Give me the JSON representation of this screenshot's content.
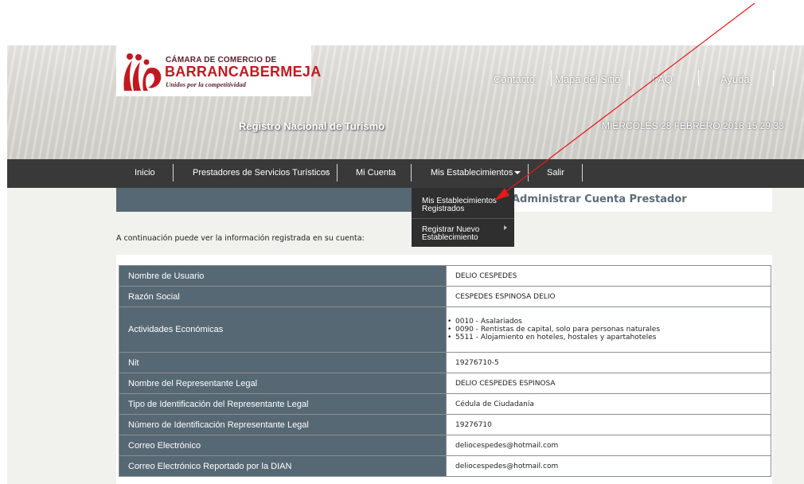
{
  "logo": {
    "line1": "CÁMARA DE COMERCIO DE",
    "line2": "BARRANCABERMEJA",
    "tagline": "Unidos por la competitividad"
  },
  "top_links": [
    "Contacto",
    "Mapa del Sitio",
    "FAQ",
    "Ayuda"
  ],
  "site_title": "Registro Nacional de Turismo",
  "datetime": "MIÉRCOLES 28 FEBRERO 2018 15:29:33",
  "nav": {
    "inicio": "Inicio",
    "prestadores": "Prestadores de Servicios Turísticos",
    "mi_cuenta": "Mi Cuenta",
    "mis_establecimientos": "Mis Establecimientos",
    "salir": "Salir"
  },
  "dropdown": {
    "item1_line1": "Mis Establecimientos",
    "item1_line2": "Registrados",
    "item2_line1": "Registrar Nuevo",
    "item2_line2": "Establecimiento"
  },
  "section_title": "Administrar Cuenta Prestador",
  "intro": "A continuación puede ver la información registrada en su cuenta:",
  "rows": [
    {
      "label": "Nombre de Usuario",
      "value": "DELIO CESPEDES"
    },
    {
      "label": "Razón Social",
      "value": "CESPEDES ESPINOSA DELIO"
    },
    {
      "label": "Actividades Económicas",
      "items": [
        "0010 - Asalariados",
        "0090 - Rentistas de capital, solo para personas naturales",
        "5511 - Alojamiento en hoteles, hostales y apartahoteles"
      ]
    },
    {
      "label": "Nit",
      "value": "19276710-5"
    },
    {
      "label": "Nombre del Representante Legal",
      "value": "DELIO CESPEDES ESPINOSA"
    },
    {
      "label": "Tipo de Identificación del Representante Legal",
      "value": "Cédula de Ciudadanía"
    },
    {
      "label": "Número de Identificación Representante Legal",
      "value": "19276710"
    },
    {
      "label": "Correo Electrónico",
      "value": "deliocespedes@hotmail.com"
    },
    {
      "label": "Correo Electrónico Reportado por la DIAN",
      "value": "deliocespedes@hotmail.com"
    }
  ],
  "colors": {
    "navbar": "#393939",
    "table_label_bg": "#566873",
    "section_title": "#5b6d78",
    "annotation_arrow": "#e11b1b",
    "logo_red": "#c21920"
  },
  "icons": [
    "logo-mark-icon",
    "caret-down-icon",
    "submenu-arrow-icon",
    "annotation-arrow-icon"
  ]
}
